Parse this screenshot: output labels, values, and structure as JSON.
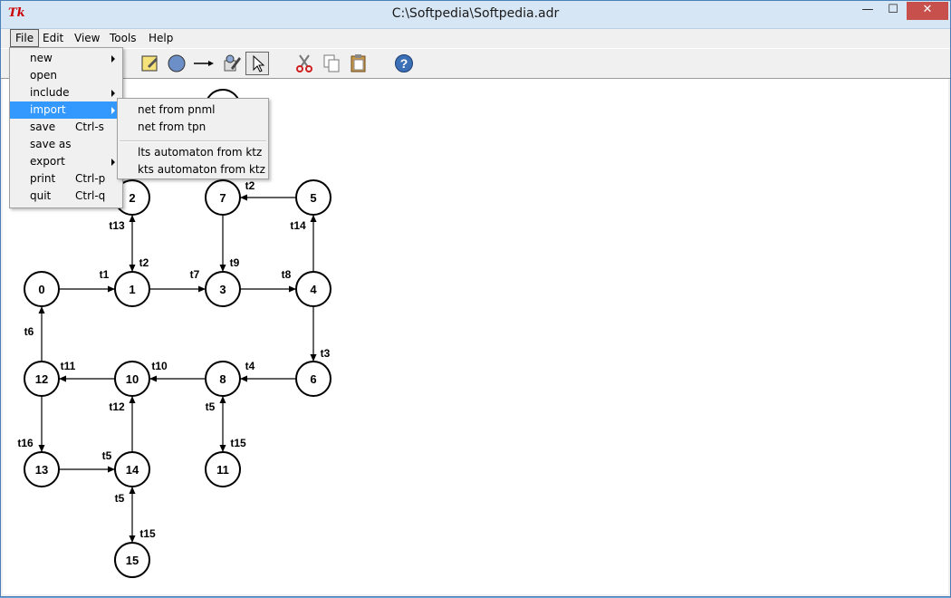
{
  "window": {
    "title": "C:\\Softpedia\\Softpedia.adr",
    "app_icon_text": "Tk"
  },
  "menubar": [
    "File",
    "Edit",
    "View",
    "Tools",
    "Help"
  ],
  "file_menu": [
    {
      "label": "new",
      "accel": "",
      "submenu": true
    },
    {
      "label": "open",
      "accel": "",
      "submenu": false
    },
    {
      "label": "include",
      "accel": "",
      "submenu": true
    },
    {
      "label": "import",
      "accel": "",
      "submenu": true,
      "highlighted": true
    },
    {
      "label": "save",
      "accel": "Ctrl-s",
      "submenu": false
    },
    {
      "label": "save as",
      "accel": "",
      "submenu": false
    },
    {
      "label": "export",
      "accel": "",
      "submenu": true
    },
    {
      "label": "print",
      "accel": "Ctrl-p",
      "submenu": false
    },
    {
      "label": "quit",
      "accel": "Ctrl-q",
      "submenu": false
    }
  ],
  "import_submenu": [
    "net from pnml",
    "net from tpn",
    "lts automaton from ktz",
    "kts automaton from ktz"
  ],
  "toolbar": [
    "edit-icon",
    "state-icon",
    "arc-icon",
    "attribute-icon",
    "select-icon",
    "cut-icon",
    "copy-icon",
    "paste-icon",
    "help-icon"
  ],
  "graph": {
    "nodes": [
      "0",
      "1",
      "2",
      "3",
      "4",
      "5",
      "6",
      "7",
      "8",
      "10",
      "11",
      "12",
      "13",
      "14",
      "15"
    ],
    "edge_labels": [
      "t1",
      "t2",
      "t3",
      "t4",
      "t5",
      "t5",
      "t5",
      "t6",
      "t7",
      "t8",
      "t9",
      "t10",
      "t11",
      "t12",
      "t13",
      "t14",
      "t15",
      "t15",
      "t16",
      "t2"
    ]
  },
  "colors": {
    "highlight": "#3399ff",
    "close_button": "#c7504c"
  }
}
